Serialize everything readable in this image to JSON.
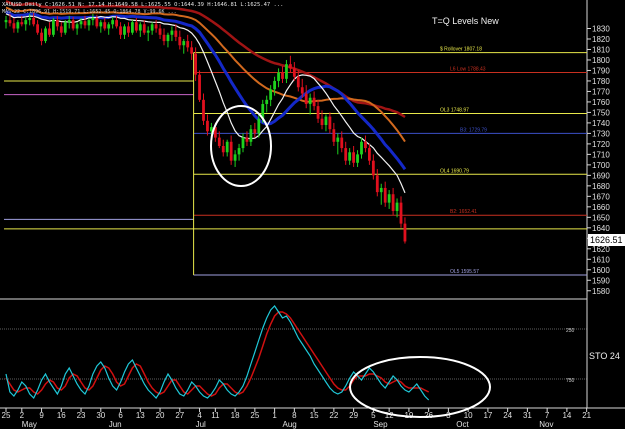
{
  "header": {
    "symbol_line": "XAUUSD Daily  C:1626.51  N:  17.14  H:1649.58  L:1625.55  O:1644.39  H:1646.81  L:1625.47 ...",
    "sub_line": "MAS-22  C:1896.91  H:1519.71  L:1652.45  O:1864.78  V:99.6K ...",
    "panel_title": "T=Q Levels New"
  },
  "price_badge": "1626.51",
  "osc_label": "STO  24",
  "colors": {
    "bull": "#1ed21e",
    "bear": "#e0101e",
    "ma_white": "#f2f2f2",
    "ma_blue": "#1428c8",
    "ma_orange": "#d2691e",
    "ma_red": "#a01414",
    "sto_k": "#1fc8d8",
    "sto_d": "#d01010"
  },
  "chart_data": {
    "type": "candlestick",
    "ylim": [
      1575,
      1840
    ],
    "y_ticks": [
      1580,
      1590,
      1600,
      1610,
      1620,
      1630,
      1640,
      1650,
      1660,
      1670,
      1680,
      1690,
      1700,
      1710,
      1720,
      1730,
      1740,
      1750,
      1760,
      1770,
      1780,
      1790,
      1800,
      1810,
      1820,
      1830
    ],
    "x_tick_labels": [
      {
        "label": "25",
        "i": 0
      },
      {
        "label": "2",
        "i": 4
      },
      {
        "label": "9",
        "i": 9
      },
      {
        "label": "16",
        "i": 14
      },
      {
        "label": "23",
        "i": 19
      },
      {
        "label": "30",
        "i": 24
      },
      {
        "label": "6",
        "i": 29
      },
      {
        "label": "13",
        "i": 34
      },
      {
        "label": "20",
        "i": 39
      },
      {
        "label": "27",
        "i": 44
      },
      {
        "label": "4",
        "i": 49
      },
      {
        "label": "11",
        "i": 53
      },
      {
        "label": "18",
        "i": 58
      },
      {
        "label": "25",
        "i": 63
      },
      {
        "label": "1",
        "i": 68
      },
      {
        "label": "8",
        "i": 73
      },
      {
        "label": "15",
        "i": 78
      },
      {
        "label": "22",
        "i": 83
      },
      {
        "label": "29",
        "i": 88
      },
      {
        "label": "5",
        "i": 93
      },
      {
        "label": "12",
        "i": 97
      },
      {
        "label": "19",
        "i": 102
      },
      {
        "label": "26",
        "i": 107
      },
      {
        "label": "3",
        "i": 112
      },
      {
        "label": "10",
        "i": 117
      },
      {
        "label": "17",
        "i": 122
      },
      {
        "label": "24",
        "i": 127
      },
      {
        "label": "31",
        "i": 132
      },
      {
        "label": "7",
        "i": 137
      },
      {
        "label": "14",
        "i": 142
      },
      {
        "label": "21",
        "i": 147
      }
    ],
    "month_labels": [
      {
        "label": "May",
        "i": 4
      },
      {
        "label": "Jun",
        "i": 26
      },
      {
        "label": "Jul",
        "i": 48
      },
      {
        "label": "Aug",
        "i": 70
      },
      {
        "label": "Sep",
        "i": 93
      },
      {
        "label": "Oct",
        "i": 114
      },
      {
        "label": "Nov",
        "i": 135
      }
    ],
    "levels": [
      {
        "name": "$ Rollover 1807.18",
        "value": 1807,
        "color": "#e8e84a",
        "from": 48
      },
      {
        "name": "L6 Low 1788.43",
        "value": 1788,
        "color": "#c83020",
        "from": 48
      },
      {
        "name": "",
        "value": 1780,
        "color": "#e8e84a",
        "from": 0,
        "to": 48
      },
      {
        "name": "OL3 1748.97",
        "value": 1749,
        "color": "#e8e84a",
        "from": 48
      },
      {
        "name": "",
        "value": 1767,
        "color": "#c864c8",
        "from": 0,
        "to": 48
      },
      {
        "name": "B3: 1729.79",
        "value": 1730,
        "color": "#3c50c8",
        "from": 48
      },
      {
        "name": "OL4 1690.79",
        "value": 1691,
        "color": "#e8e84a",
        "from": 48
      },
      {
        "name": "B2: 1652.41",
        "value": 1652,
        "color": "#c83020",
        "from": 48
      },
      {
        "name": "",
        "value": 1648,
        "color": "#a0a0e0",
        "from": 0,
        "to": 48
      },
      {
        "name": "",
        "value": 1639,
        "color": "#e8e84a",
        "from": 0
      },
      {
        "name": "OL5 1595.57",
        "value": 1595,
        "color": "#a0a0e0",
        "from": 48
      }
    ],
    "candles": [
      [
        1836,
        1842,
        1830,
        1838
      ],
      [
        1838,
        1844,
        1832,
        1835
      ],
      [
        1835,
        1840,
        1826,
        1830
      ],
      [
        1830,
        1838,
        1826,
        1836
      ],
      [
        1836,
        1842,
        1832,
        1834
      ],
      [
        1834,
        1840,
        1828,
        1838
      ],
      [
        1838,
        1844,
        1833,
        1840
      ],
      [
        1840,
        1845,
        1832,
        1834
      ],
      [
        1834,
        1838,
        1824,
        1826
      ],
      [
        1826,
        1830,
        1814,
        1818
      ],
      [
        1818,
        1832,
        1816,
        1830
      ],
      [
        1830,
        1836,
        1822,
        1824
      ],
      [
        1824,
        1840,
        1822,
        1838
      ],
      [
        1838,
        1842,
        1828,
        1832
      ],
      [
        1832,
        1836,
        1822,
        1826
      ],
      [
        1826,
        1838,
        1824,
        1836
      ],
      [
        1836,
        1842,
        1830,
        1838
      ],
      [
        1838,
        1841,
        1828,
        1830
      ],
      [
        1830,
        1836,
        1824,
        1834
      ],
      [
        1834,
        1840,
        1830,
        1837
      ],
      [
        1837,
        1842,
        1830,
        1833
      ],
      [
        1833,
        1840,
        1828,
        1838
      ],
      [
        1838,
        1844,
        1833,
        1840
      ],
      [
        1840,
        1843,
        1830,
        1832
      ],
      [
        1832,
        1838,
        1826,
        1836
      ],
      [
        1836,
        1840,
        1828,
        1830
      ],
      [
        1830,
        1836,
        1824,
        1834
      ],
      [
        1834,
        1841,
        1830,
        1838
      ],
      [
        1838,
        1842,
        1830,
        1832
      ],
      [
        1832,
        1836,
        1820,
        1824
      ],
      [
        1824,
        1834,
        1820,
        1832
      ],
      [
        1832,
        1836,
        1822,
        1826
      ],
      [
        1826,
        1838,
        1824,
        1836
      ],
      [
        1836,
        1840,
        1826,
        1828
      ],
      [
        1828,
        1836,
        1822,
        1834
      ],
      [
        1834,
        1838,
        1824,
        1826
      ],
      [
        1826,
        1832,
        1818,
        1828
      ],
      [
        1828,
        1836,
        1824,
        1834
      ],
      [
        1834,
        1838,
        1826,
        1830
      ],
      [
        1830,
        1834,
        1820,
        1824
      ],
      [
        1824,
        1830,
        1814,
        1818
      ],
      [
        1818,
        1826,
        1812,
        1824
      ],
      [
        1824,
        1832,
        1818,
        1828
      ],
      [
        1828,
        1834,
        1818,
        1822
      ],
      [
        1822,
        1828,
        1810,
        1814
      ],
      [
        1814,
        1820,
        1806,
        1818
      ],
      [
        1818,
        1824,
        1808,
        1812
      ],
      [
        1812,
        1818,
        1800,
        1806
      ],
      [
        1806,
        1812,
        1780,
        1786
      ],
      [
        1786,
        1790,
        1760,
        1762
      ],
      [
        1762,
        1768,
        1738,
        1742
      ],
      [
        1742,
        1748,
        1728,
        1732
      ],
      [
        1732,
        1740,
        1726,
        1736
      ],
      [
        1736,
        1740,
        1722,
        1726
      ],
      [
        1726,
        1732,
        1716,
        1718
      ],
      [
        1718,
        1724,
        1708,
        1712
      ],
      [
        1712,
        1724,
        1708,
        1722
      ],
      [
        1722,
        1728,
        1700,
        1704
      ],
      [
        1704,
        1714,
        1698,
        1710
      ],
      [
        1710,
        1720,
        1704,
        1716
      ],
      [
        1716,
        1730,
        1712,
        1726
      ],
      [
        1726,
        1732,
        1718,
        1722
      ],
      [
        1722,
        1738,
        1718,
        1734
      ],
      [
        1734,
        1740,
        1726,
        1730
      ],
      [
        1730,
        1748,
        1726,
        1744
      ],
      [
        1744,
        1762,
        1740,
        1758
      ],
      [
        1758,
        1766,
        1750,
        1762
      ],
      [
        1762,
        1776,
        1756,
        1772
      ],
      [
        1772,
        1784,
        1766,
        1780
      ],
      [
        1780,
        1792,
        1774,
        1788
      ],
      [
        1788,
        1794,
        1778,
        1782
      ],
      [
        1782,
        1800,
        1778,
        1796
      ],
      [
        1796,
        1804,
        1788,
        1792
      ],
      [
        1792,
        1798,
        1780,
        1784
      ],
      [
        1784,
        1790,
        1770,
        1774
      ],
      [
        1774,
        1782,
        1764,
        1768
      ],
      [
        1768,
        1776,
        1754,
        1758
      ],
      [
        1758,
        1768,
        1748,
        1764
      ],
      [
        1764,
        1770,
        1752,
        1756
      ],
      [
        1756,
        1762,
        1740,
        1744
      ],
      [
        1744,
        1752,
        1734,
        1738
      ],
      [
        1738,
        1748,
        1732,
        1746
      ],
      [
        1746,
        1750,
        1730,
        1734
      ],
      [
        1734,
        1740,
        1718,
        1722
      ],
      [
        1722,
        1730,
        1710,
        1726
      ],
      [
        1726,
        1732,
        1712,
        1716
      ],
      [
        1716,
        1722,
        1700,
        1704
      ],
      [
        1704,
        1716,
        1700,
        1712
      ],
      [
        1712,
        1718,
        1698,
        1702
      ],
      [
        1702,
        1714,
        1698,
        1710
      ],
      [
        1710,
        1726,
        1706,
        1722
      ],
      [
        1722,
        1728,
        1712,
        1716
      ],
      [
        1716,
        1720,
        1700,
        1704
      ],
      [
        1704,
        1710,
        1686,
        1690
      ],
      [
        1690,
        1696,
        1670,
        1674
      ],
      [
        1674,
        1682,
        1662,
        1678
      ],
      [
        1678,
        1684,
        1660,
        1664
      ],
      [
        1664,
        1676,
        1658,
        1672
      ],
      [
        1672,
        1678,
        1652,
        1656
      ],
      [
        1656,
        1668,
        1650,
        1664
      ],
      [
        1664,
        1670,
        1640,
        1644
      ],
      [
        1644,
        1650,
        1625,
        1627
      ]
    ],
    "sto_ylim": [
      0,
      100
    ],
    "sto_levels": [
      {
        "label": "750",
        "value": 25
      },
      {
        "label": "250",
        "value": 75
      }
    ],
    "sto_k": [
      30,
      12,
      8,
      14,
      22,
      18,
      10,
      6,
      14,
      24,
      30,
      22,
      16,
      10,
      18,
      30,
      36,
      28,
      20,
      14,
      10,
      18,
      30,
      38,
      42,
      36,
      26,
      18,
      14,
      22,
      32,
      40,
      44,
      36,
      28,
      20,
      14,
      10,
      6,
      12,
      22,
      30,
      24,
      16,
      10,
      8,
      14,
      22,
      18,
      12,
      8,
      6,
      10,
      16,
      24,
      20,
      14,
      10,
      8,
      12,
      18,
      28,
      40,
      52,
      64,
      76,
      86,
      94,
      98,
      92,
      86,
      88,
      82,
      74,
      66,
      60,
      54,
      48,
      40,
      34,
      28,
      22,
      16,
      12,
      10,
      12,
      18,
      26,
      32,
      28,
      24,
      30,
      36,
      32,
      26,
      20,
      16,
      22,
      28,
      24,
      18,
      14,
      12,
      16,
      20,
      14,
      8,
      4
    ],
    "sto_d": [
      26,
      20,
      14,
      12,
      14,
      16,
      16,
      12,
      10,
      14,
      20,
      24,
      22,
      16,
      14,
      18,
      26,
      30,
      28,
      22,
      16,
      14,
      18,
      26,
      34,
      38,
      36,
      30,
      22,
      18,
      20,
      28,
      36,
      40,
      38,
      30,
      22,
      16,
      12,
      10,
      12,
      18,
      24,
      24,
      18,
      12,
      10,
      14,
      18,
      18,
      14,
      10,
      8,
      10,
      16,
      20,
      20,
      16,
      12,
      10,
      12,
      18,
      26,
      36,
      46,
      58,
      70,
      80,
      88,
      92,
      92,
      90,
      86,
      80,
      74,
      68,
      62,
      56,
      50,
      44,
      38,
      32,
      26,
      20,
      16,
      14,
      14,
      18,
      24,
      28,
      28,
      28,
      30,
      30,
      28,
      26,
      22,
      20,
      22,
      24,
      22,
      18,
      16,
      16,
      16,
      16,
      14,
      12
    ]
  }
}
